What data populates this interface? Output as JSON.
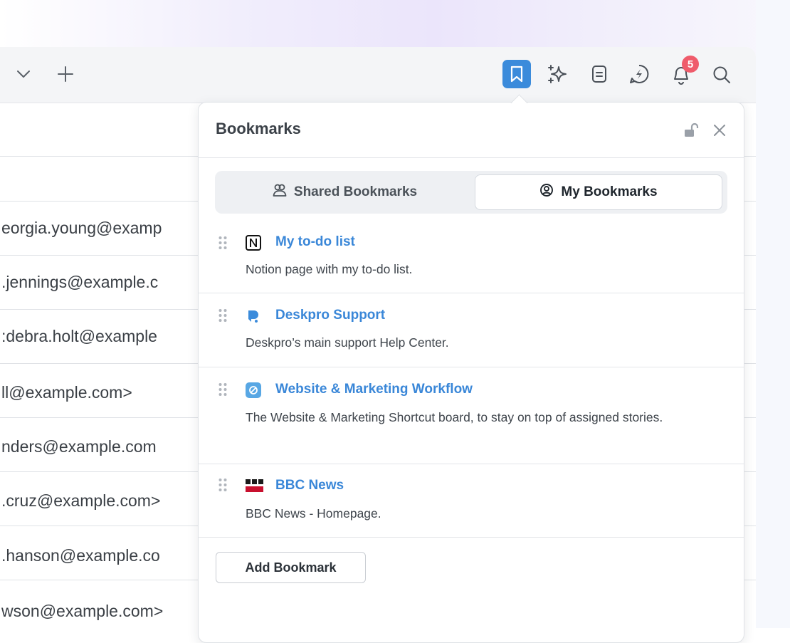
{
  "toolbar": {
    "notifications_badge": "5",
    "icons": [
      "chevron-down-icon",
      "plus-icon",
      "bookmark-icon",
      "sparkle-icon",
      "document-icon",
      "lightning-chat-icon",
      "bell-icon",
      "search-icon"
    ],
    "accent_color": "#3b8bdb"
  },
  "email_list": [
    {
      "email": "eorgia.young@examp"
    },
    {
      "email": ".jennings@example.c"
    },
    {
      "email": ":debra.holt@example"
    },
    {
      "email": "ll@example.com>"
    },
    {
      "email": "nders@example.com"
    },
    {
      "email": ".cruz@example.com>"
    },
    {
      "email": ".hanson@example.co"
    },
    {
      "email": "wson@example.com>"
    }
  ],
  "bookmarks_panel": {
    "title": "Bookmarks",
    "tabs": [
      {
        "label": "Shared Bookmarks",
        "icon": "users-icon",
        "active": false
      },
      {
        "label": "My Bookmarks",
        "icon": "user-circle-icon",
        "active": true
      }
    ],
    "items": [
      {
        "name": "My to-do list",
        "description": "Notion page with my to-do list.",
        "icon": "notion-logo-icon"
      },
      {
        "name": "Deskpro Support",
        "description": "Deskpro’s main support Help Center.",
        "icon": "deskpro-logo-icon"
      },
      {
        "name": "Website & Marketing Workflow",
        "description": "The Website & Marketing Shortcut board, to stay on top of assigned stories.",
        "icon": "shortcut-logo-icon"
      },
      {
        "name": "BBC News",
        "description": "BBC News - Homepage.",
        "icon": "bbc-news-logo-icon"
      }
    ],
    "add_button_label": "Add Bookmark",
    "link_color": "#3a87d8"
  }
}
